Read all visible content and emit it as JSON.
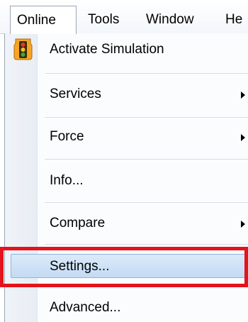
{
  "menubar": {
    "items": [
      {
        "label": "Online"
      },
      {
        "label": "Tools"
      },
      {
        "label": "Window"
      },
      {
        "label": "He"
      }
    ]
  },
  "online_menu": {
    "items": [
      {
        "label": "Activate Simulation",
        "icon": "traffic-light-icon"
      },
      {
        "label": "Services",
        "submenu": true
      },
      {
        "label": "Force",
        "submenu": true
      },
      {
        "label": "Info..."
      },
      {
        "label": "Compare",
        "submenu": true
      },
      {
        "label": "Settings...",
        "highlighted": true
      },
      {
        "label": "Advanced..."
      }
    ]
  },
  "colors": {
    "highlight_fill": "#c8def5",
    "highlight_border": "#8fb6e0",
    "annotation_red": "#e3141b",
    "icon_orange": "#f6a623"
  }
}
